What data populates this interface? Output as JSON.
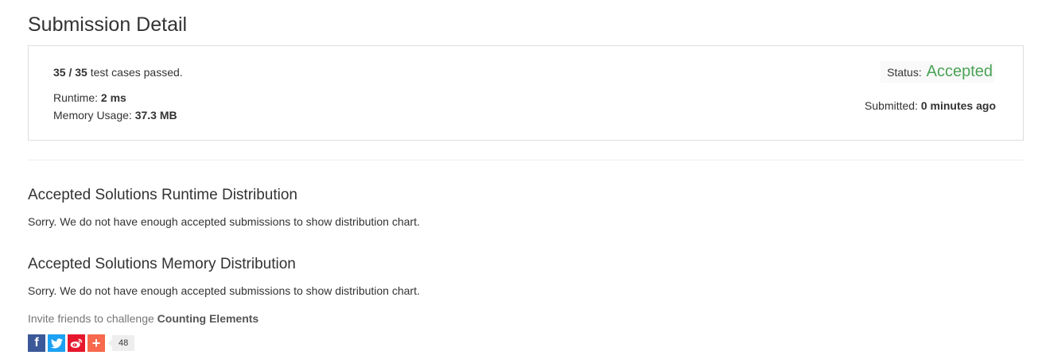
{
  "page_title": "Submission Detail",
  "result": {
    "passed_count": "35 / 35",
    "passed_suffix": " test cases passed.",
    "runtime_label": "Runtime: ",
    "runtime_value": "2 ms",
    "memory_label": "Memory Usage: ",
    "memory_value": "37.3 MB",
    "status_label": "Status: ",
    "status_value": "Accepted",
    "submitted_label": "Submitted: ",
    "submitted_value": "0 minutes ago"
  },
  "runtime_section": {
    "heading": "Accepted Solutions Runtime Distribution",
    "message": "Sorry. We do not have enough accepted submissions to show distribution chart."
  },
  "memory_section": {
    "heading": "Accepted Solutions Memory Distribution",
    "message": "Sorry. We do not have enough accepted submissions to show distribution chart."
  },
  "invite": {
    "prefix": "Invite friends to challenge ",
    "problem_name": "Counting Elements"
  },
  "share": {
    "buttons": [
      {
        "icon": "facebook-icon",
        "glyph": "f"
      },
      {
        "icon": "twitter-icon",
        "glyph": "🐦"
      },
      {
        "icon": "weibo-icon",
        "glyph": "微"
      },
      {
        "icon": "plus-icon",
        "glyph": "+"
      }
    ],
    "count": "48"
  },
  "colors": {
    "accepted": "#4aa356",
    "facebook": "#3b5998",
    "twitter": "#1da1f2",
    "weibo": "#e6162d",
    "more": "#f8694d"
  }
}
